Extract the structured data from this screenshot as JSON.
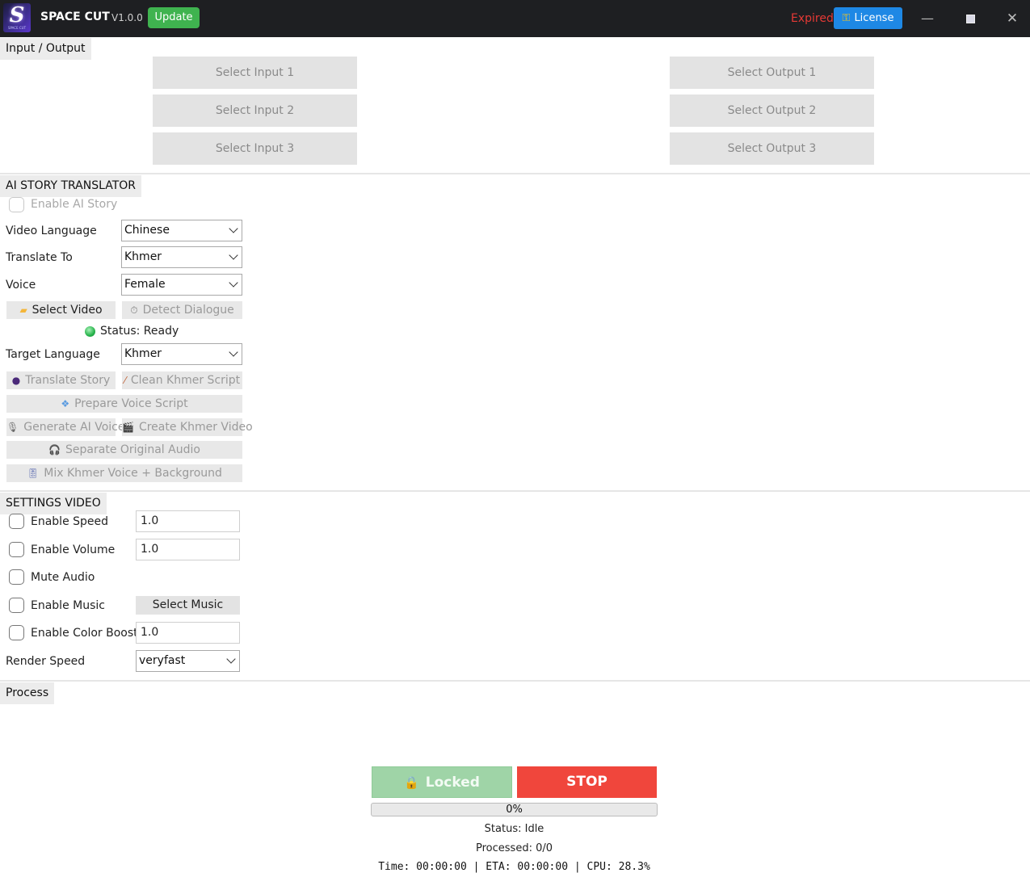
{
  "titlebar": {
    "logo_letter": "S",
    "logo_small_text": "SPACE CUT",
    "app_name": "SPACE CUT",
    "version": "V1.0.0",
    "update_label": "Update",
    "license_status": "Expired",
    "license_label": "License",
    "minimize_glyph": "—",
    "close_glyph": "✕"
  },
  "io": {
    "section_title": "Input / Output",
    "inputs": [
      "Select Input 1",
      "Select Input 2",
      "Select Input 3"
    ],
    "outputs": [
      "Select Output 1",
      "Select Output 2",
      "Select Output 3"
    ]
  },
  "ai": {
    "section_title": "AI STORY TRANSLATOR",
    "enable_label": "Enable AI Story",
    "video_language_label": "Video Language",
    "video_language_value": "Chinese",
    "translate_to_label": "Translate To",
    "translate_to_value": "Khmer",
    "voice_label": "Voice",
    "voice_value": "Female",
    "select_video_label": "Select Video",
    "detect_dialogue_label": "Detect Dialogue",
    "status_text": "Status: Ready",
    "target_language_label": "Target Language",
    "target_language_value": "Khmer",
    "translate_story_label": "Translate Story",
    "clean_script_label": "Clean Khmer Script",
    "prepare_voice_label": "Prepare Voice Script",
    "generate_voice_label": "Generate AI Voice",
    "create_video_label": "Create Khmer Video",
    "separate_audio_label": "Separate Original Audio",
    "mix_voice_label": "Mix Khmer Voice + Background"
  },
  "settings": {
    "section_title": "SETTINGS VIDEO",
    "enable_speed_label": "Enable Speed",
    "speed_value": "1.0",
    "enable_volume_label": "Enable Volume",
    "volume_value": "1.0",
    "mute_audio_label": "Mute Audio",
    "enable_music_label": "Enable Music",
    "select_music_label": "Select Music",
    "color_boost_label": "Enable Color Boost",
    "color_boost_value": "1.0",
    "render_speed_label": "Render Speed",
    "render_speed_value": "veryfast"
  },
  "process": {
    "section_title": "Process",
    "locked_label": "Locked",
    "stop_label": "STOP",
    "progress_text": "0%",
    "status_text": "Status: Idle",
    "processed_text": "Processed: 0/0",
    "metrics_text": "Time: 00:00:00 | ETA: 00:00:00 | CPU: 28.3%"
  },
  "colors": {
    "titlebar_bg": "#1e1f22",
    "update_green": "#3fb34f",
    "expired_red": "#e53935",
    "license_blue": "#1e88e5",
    "locked_green": "#9fd4a7",
    "stop_red": "#f0463c"
  },
  "icons": {
    "license": "key-icon",
    "select_video": "folder-icon",
    "detect_dialogue": "stopwatch-icon",
    "translate_story": "speaking-head-icon",
    "clean_script": "brush-icon",
    "prepare_voice": "speech-bubbles-icon",
    "generate_voice": "microphone-icon",
    "create_video": "clapperboard-icon",
    "separate_audio": "headphones-icon",
    "mix_voice": "mixer-icon",
    "locked": "lock-icon"
  }
}
